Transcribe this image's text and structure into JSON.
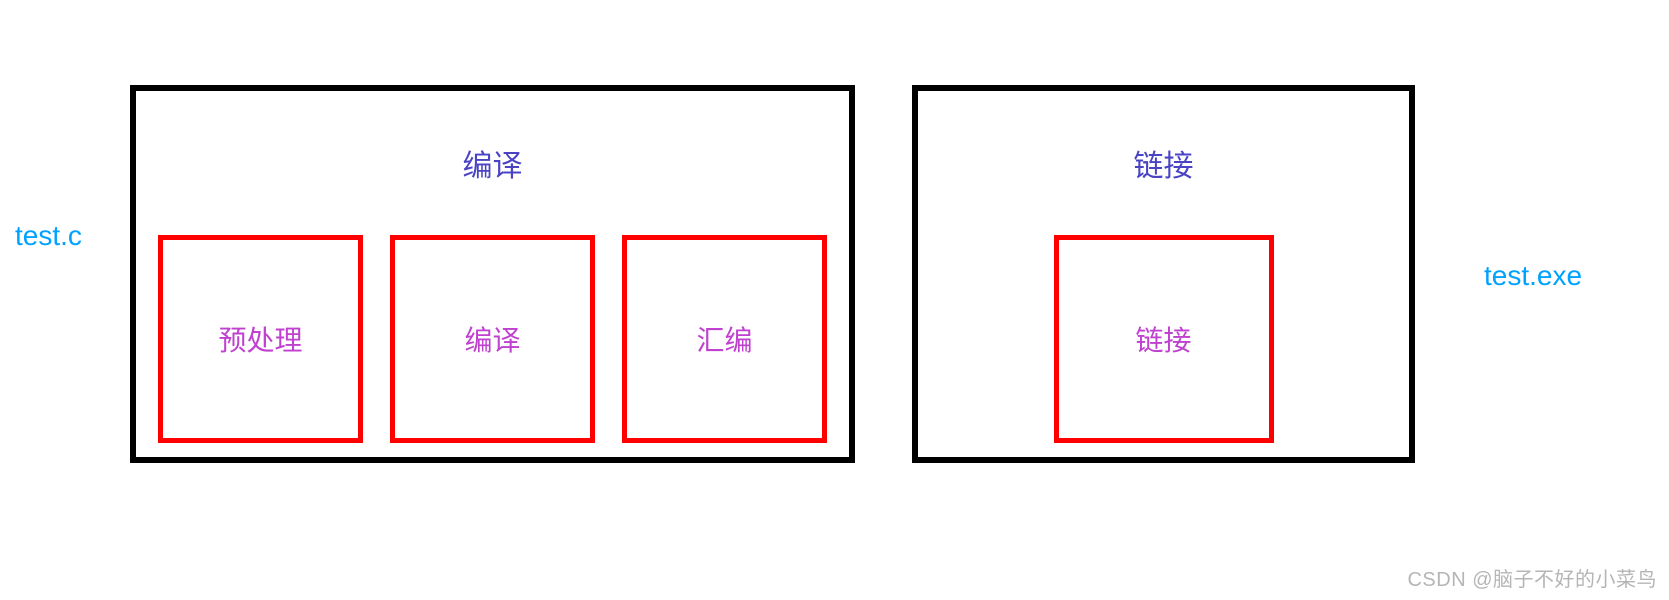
{
  "input_file": "test.c",
  "output_file": "test.exe",
  "compile": {
    "title": "编译",
    "stages": [
      "预处理",
      "编译",
      "汇编"
    ]
  },
  "link": {
    "title": "链接",
    "stage": "链接"
  },
  "watermark": "CSDN @脑子不好的小菜鸟"
}
